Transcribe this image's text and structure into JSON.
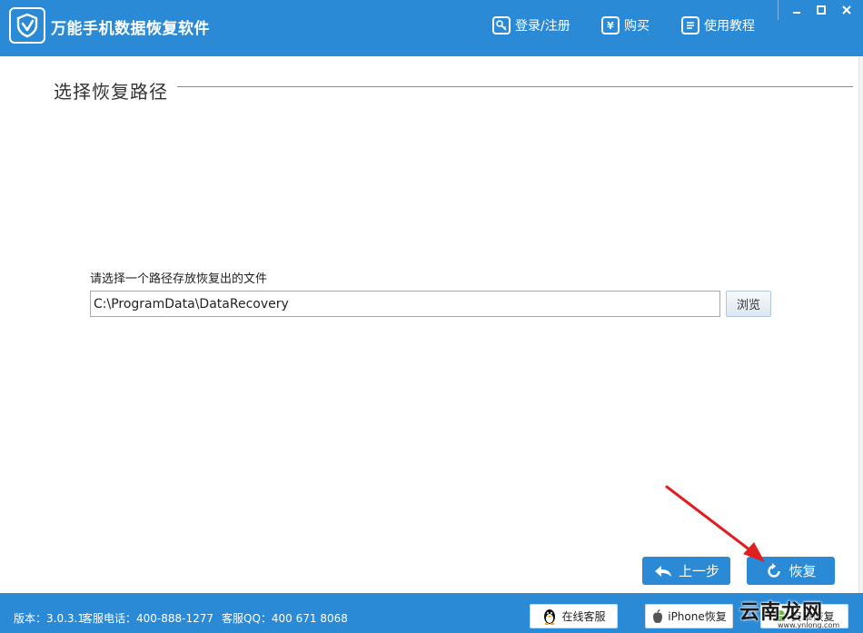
{
  "app": {
    "title": "万能手机数据恢复软件",
    "brand_color": "#2b8ad6"
  },
  "topnav": {
    "login": {
      "label": "登录/注册",
      "icon": "key-icon"
    },
    "buy": {
      "label": "购买",
      "icon": "yen-icon",
      "glyph": "¥"
    },
    "tutorial": {
      "label": "使用教程",
      "icon": "document-icon"
    }
  },
  "window_controls": [
    "minimize",
    "maximize",
    "close"
  ],
  "section": {
    "title": "选择恢复路径"
  },
  "path_form": {
    "label": "请选择一个路径存放恢复出的文件",
    "value": "C:\\ProgramData\\DataRecovery",
    "browse_label": "浏览"
  },
  "actions": {
    "prev_label": "上一步",
    "recover_label": "恢复"
  },
  "annotation": {
    "arrow_color": "#e02020"
  },
  "footer": {
    "version": "版本：3.0.3.1",
    "phone": "客服电话：400-888-1277",
    "qq": "客服QQ：400 671 8068",
    "buttons": {
      "online_service": "在线客服",
      "iphone_recover": "iPhone恢复",
      "android_recover": "安卓恢复"
    }
  },
  "watermark": {
    "text": "云南龙网",
    "sub": "www.ynlong.com"
  }
}
